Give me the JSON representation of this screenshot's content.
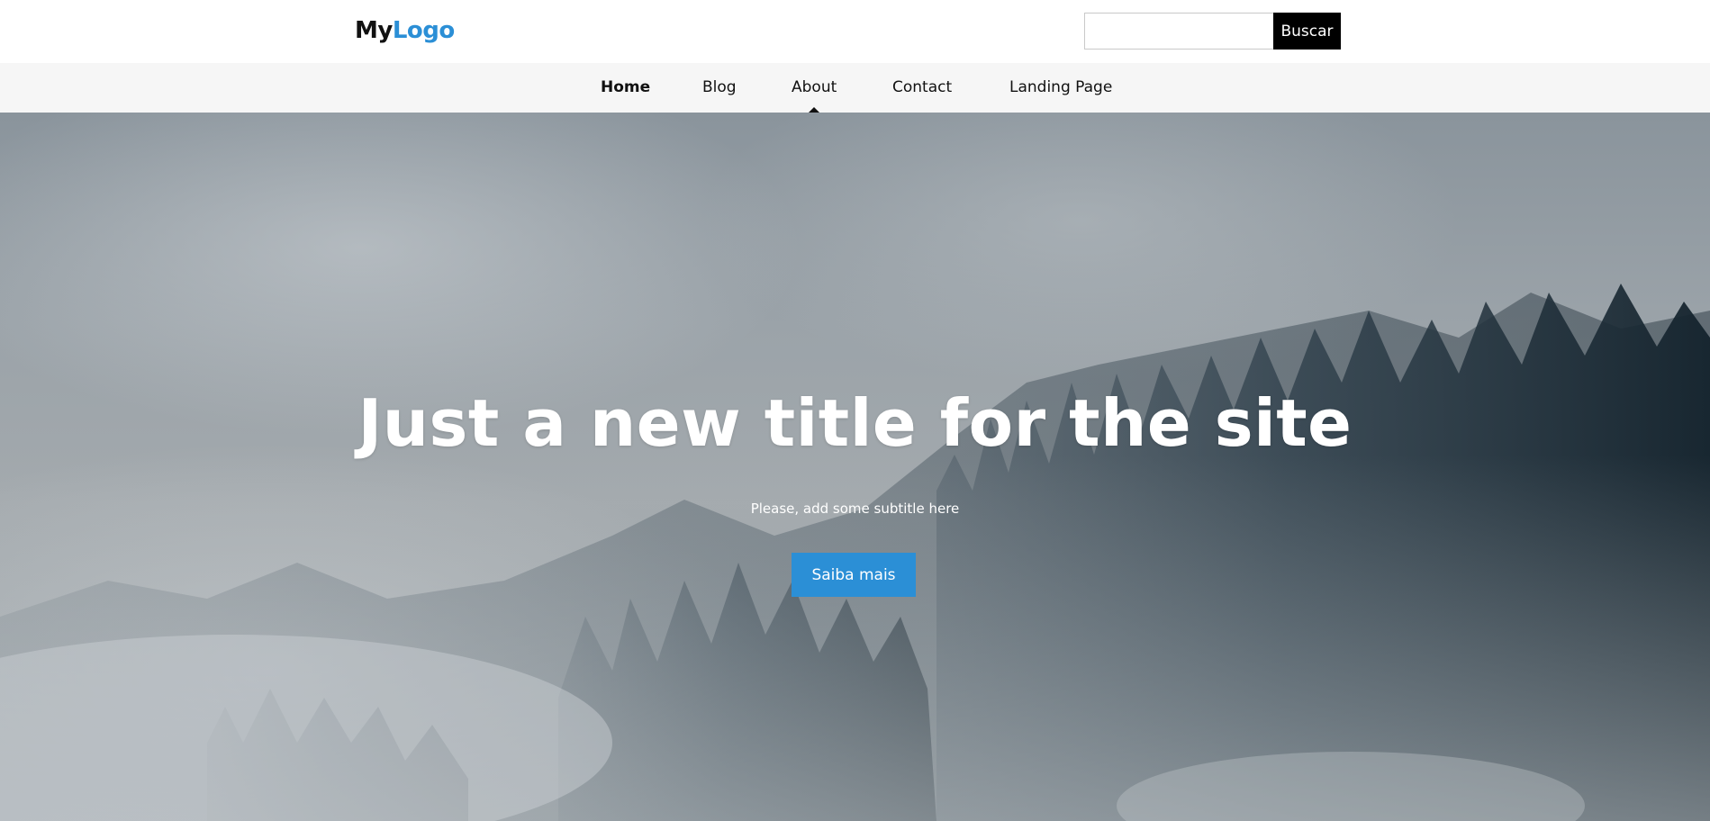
{
  "brand": {
    "logo_part1": "My",
    "logo_part2": "Logo"
  },
  "search": {
    "placeholder": "",
    "value": "",
    "button_label": "Buscar"
  },
  "nav": {
    "items": [
      {
        "label": "Home",
        "active": true
      },
      {
        "label": "Blog"
      },
      {
        "label": "About",
        "hovered": true
      },
      {
        "label": "Contact"
      },
      {
        "label": "Landing Page"
      }
    ]
  },
  "hero": {
    "title": "Just a new title for the site",
    "subtitle": "Please, add some subtitle here",
    "cta_label": "Saiba mais"
  },
  "colors": {
    "accent": "#2b8fd6",
    "search_button": "#000000",
    "nav_background": "#f6f6f6"
  }
}
